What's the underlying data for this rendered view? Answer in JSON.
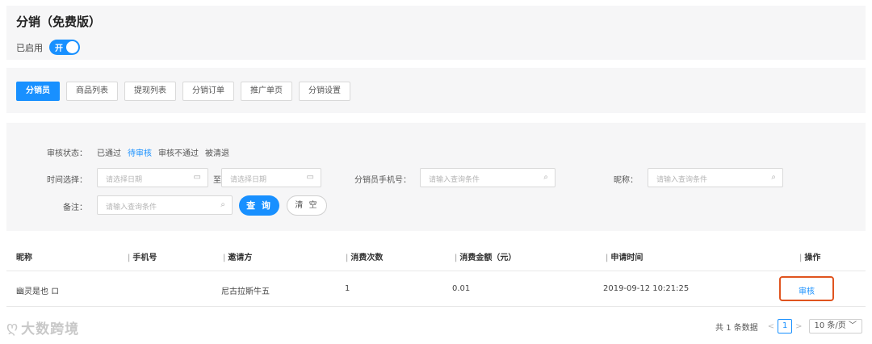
{
  "header": {
    "title": "分销（免费版）",
    "status_label": "已启用",
    "switch_text": "开"
  },
  "tabs": [
    {
      "label": "分销员",
      "active": true
    },
    {
      "label": "商品列表",
      "active": false
    },
    {
      "label": "提现列表",
      "active": false
    },
    {
      "label": "分销订单",
      "active": false
    },
    {
      "label": "推广单页",
      "active": false
    },
    {
      "label": "分销设置",
      "active": false
    }
  ],
  "filter": {
    "status_label": "审核状态：",
    "status_options": [
      "已通过",
      "待审核",
      "审核不通过",
      "被清退"
    ],
    "status_active": "待审核",
    "time_label": "时间选择：",
    "date_placeholder": "请选择日期",
    "to_label": "至",
    "phone_label": "分销员手机号：",
    "query_placeholder": "请输入查询条件",
    "nickname_label": "昵称：",
    "note_label": "备注：",
    "query_button": "查 询",
    "clear_button": "清 空"
  },
  "table": {
    "columns": [
      "昵称",
      "手机号",
      "邀请方",
      "消费次数",
      "消费金额（元）",
      "申请时间",
      "操作"
    ],
    "rows": [
      {
        "nickname": "幽灵是也 ロ",
        "phone": "",
        "inviter": "尼古拉斯牛五",
        "count": "1",
        "amount": "0.01",
        "apply_time": "2019-09-12 10:21:25",
        "action": "审核"
      }
    ]
  },
  "footer": {
    "logo_text": "大数跨境",
    "total": "共 1 条数据",
    "current_page": "1",
    "page_size": "10 条/页"
  },
  "colors": {
    "accent": "#1890ff",
    "highlight_box": "#e0541f",
    "panel_bg": "#f6f6f7"
  }
}
